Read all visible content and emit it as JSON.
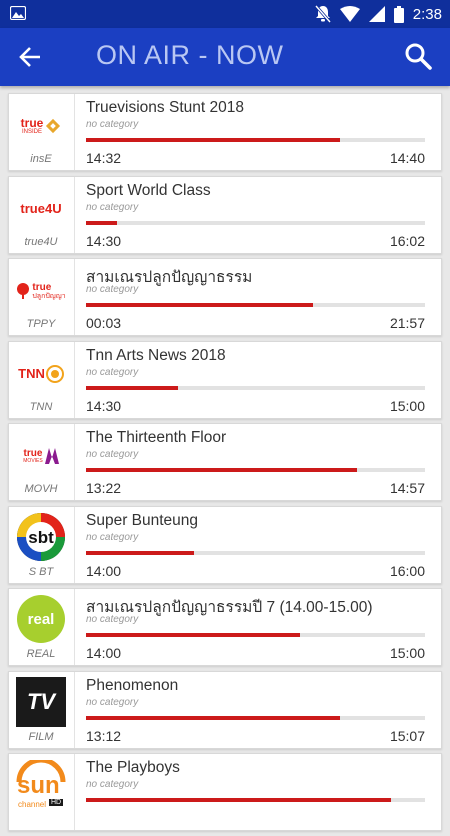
{
  "status_bar": {
    "time": "2:38"
  },
  "app_bar": {
    "title": "ON AIR - NOW"
  },
  "programs": [
    {
      "channel": "insE",
      "title": "Truevisions Stunt 2018",
      "category": "no category",
      "start": "14:32",
      "end": "14:40",
      "progress": 0.75
    },
    {
      "channel": "true4U",
      "title": "Sport World Class",
      "category": "no category",
      "start": "14:30",
      "end": "16:02",
      "progress": 0.09
    },
    {
      "channel": "TPPY",
      "title": "สามเณรปลูกปัญญาธรรม",
      "category": "no category",
      "start": "00:03",
      "end": "21:57",
      "progress": 0.67
    },
    {
      "channel": "TNN",
      "title": "Tnn Arts News 2018",
      "category": "no category",
      "start": "14:30",
      "end": "15:00",
      "progress": 0.27
    },
    {
      "channel": "MOVH",
      "title": "The Thirteenth Floor",
      "category": "no category",
      "start": "13:22",
      "end": "14:57",
      "progress": 0.8
    },
    {
      "channel": "S BT",
      "title": "Super Bunteung",
      "category": "no category",
      "start": "14:00",
      "end": "16:00",
      "progress": 0.32
    },
    {
      "channel": "REAL",
      "title": "สามเณรปลูกปัญญาธรรมปี 7 (14.00-15.00)",
      "category": "no category",
      "start": "14:00",
      "end": "15:00",
      "progress": 0.63
    },
    {
      "channel": "FILM",
      "title": "Phenomenon",
      "category": "no category",
      "start": "13:12",
      "end": "15:07",
      "progress": 0.75
    },
    {
      "channel": "",
      "title": "The Playboys",
      "category": "no category",
      "start": "",
      "end": "",
      "progress": 0.9
    }
  ],
  "logos": {
    "l0": "true",
    "l0b": "INSIDE",
    "l1": "true4U",
    "l2": "true",
    "l2b": "ปลูกปัญญา",
    "l3": "TNN",
    "l4": "true",
    "l4b": "MOVIES",
    "l5": "sbt",
    "l6": "real",
    "l7": "TV",
    "l8": "sun",
    "l8b": "channel",
    "l8c": "HD"
  },
  "colors": {
    "status_bar": "#0f2f9c",
    "app_bar": "#1b3fc2",
    "progress": "#cc1a1a",
    "track": "#e2e2e2"
  }
}
